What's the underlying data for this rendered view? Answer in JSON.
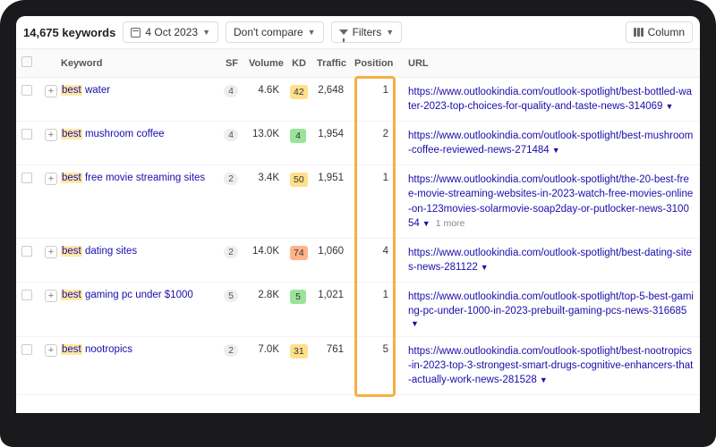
{
  "toolbar": {
    "keyword_count": "14,675 keywords",
    "date_label": "4 Oct 2023",
    "compare_label": "Don't compare",
    "filters_label": "Filters",
    "columns_label": "Column"
  },
  "columns": {
    "keyword": "Keyword",
    "sf": "SF",
    "volume": "Volume",
    "kd": "KD",
    "traffic": "Traffic",
    "position": "Position",
    "url": "URL"
  },
  "kd_colors": {
    "easy": "#9be39b",
    "med": "#ffe08a",
    "hard": "#ffb38a"
  },
  "rows": [
    {
      "keyword_prefix": "best",
      "keyword_rest": " water",
      "sf": "4",
      "volume": "4.6K",
      "kd": "42",
      "kd_level": "med",
      "traffic": "2,648",
      "position": "1",
      "url": "https://www.outlookindia.com/outlook-spotlight/best-bottled-water-2023-top-choices-for-quality-and-taste-news-314069",
      "more": ""
    },
    {
      "keyword_prefix": "best",
      "keyword_rest": " mushroom coffee",
      "sf": "4",
      "volume": "13.0K",
      "kd": "4",
      "kd_level": "easy",
      "traffic": "1,954",
      "position": "2",
      "url": "https://www.outlookindia.com/outlook-spotlight/best-mushroom-coffee-reviewed-news-271484",
      "more": ""
    },
    {
      "keyword_prefix": "best",
      "keyword_rest": " free movie streaming sites",
      "sf": "2",
      "volume": "3.4K",
      "kd": "50",
      "kd_level": "med",
      "traffic": "1,951",
      "position": "1",
      "url": "https://www.outlookindia.com/outlook-spotlight/the-20-best-free-movie-streaming-websites-in-2023-watch-free-movies-online-on-123movies-solarmovie-soap2day-or-putlocker-news-310054",
      "more": "1 more"
    },
    {
      "keyword_prefix": "best",
      "keyword_rest": " dating sites",
      "sf": "2",
      "volume": "14.0K",
      "kd": "74",
      "kd_level": "hard",
      "traffic": "1,060",
      "position": "4",
      "url": "https://www.outlookindia.com/outlook-spotlight/best-dating-sites-news-281122",
      "more": ""
    },
    {
      "keyword_prefix": "best",
      "keyword_rest": " gaming pc under $1000",
      "sf": "5",
      "volume": "2.8K",
      "kd": "5",
      "kd_level": "easy",
      "traffic": "1,021",
      "position": "1",
      "url": "https://www.outlookindia.com/outlook-spotlight/top-5-best-gaming-pc-under-1000-in-2023-prebuilt-gaming-pcs-news-316685",
      "more": ""
    },
    {
      "keyword_prefix": "best",
      "keyword_rest": " nootropics",
      "sf": "2",
      "volume": "7.0K",
      "kd": "31",
      "kd_level": "med",
      "traffic": "761",
      "position": "5",
      "url": "https://www.outlookindia.com/outlook-spotlight/best-nootropics-in-2023-top-3-strongest-smart-drugs-cognitive-enhancers-that-actually-work-news-281528",
      "more": ""
    }
  ]
}
